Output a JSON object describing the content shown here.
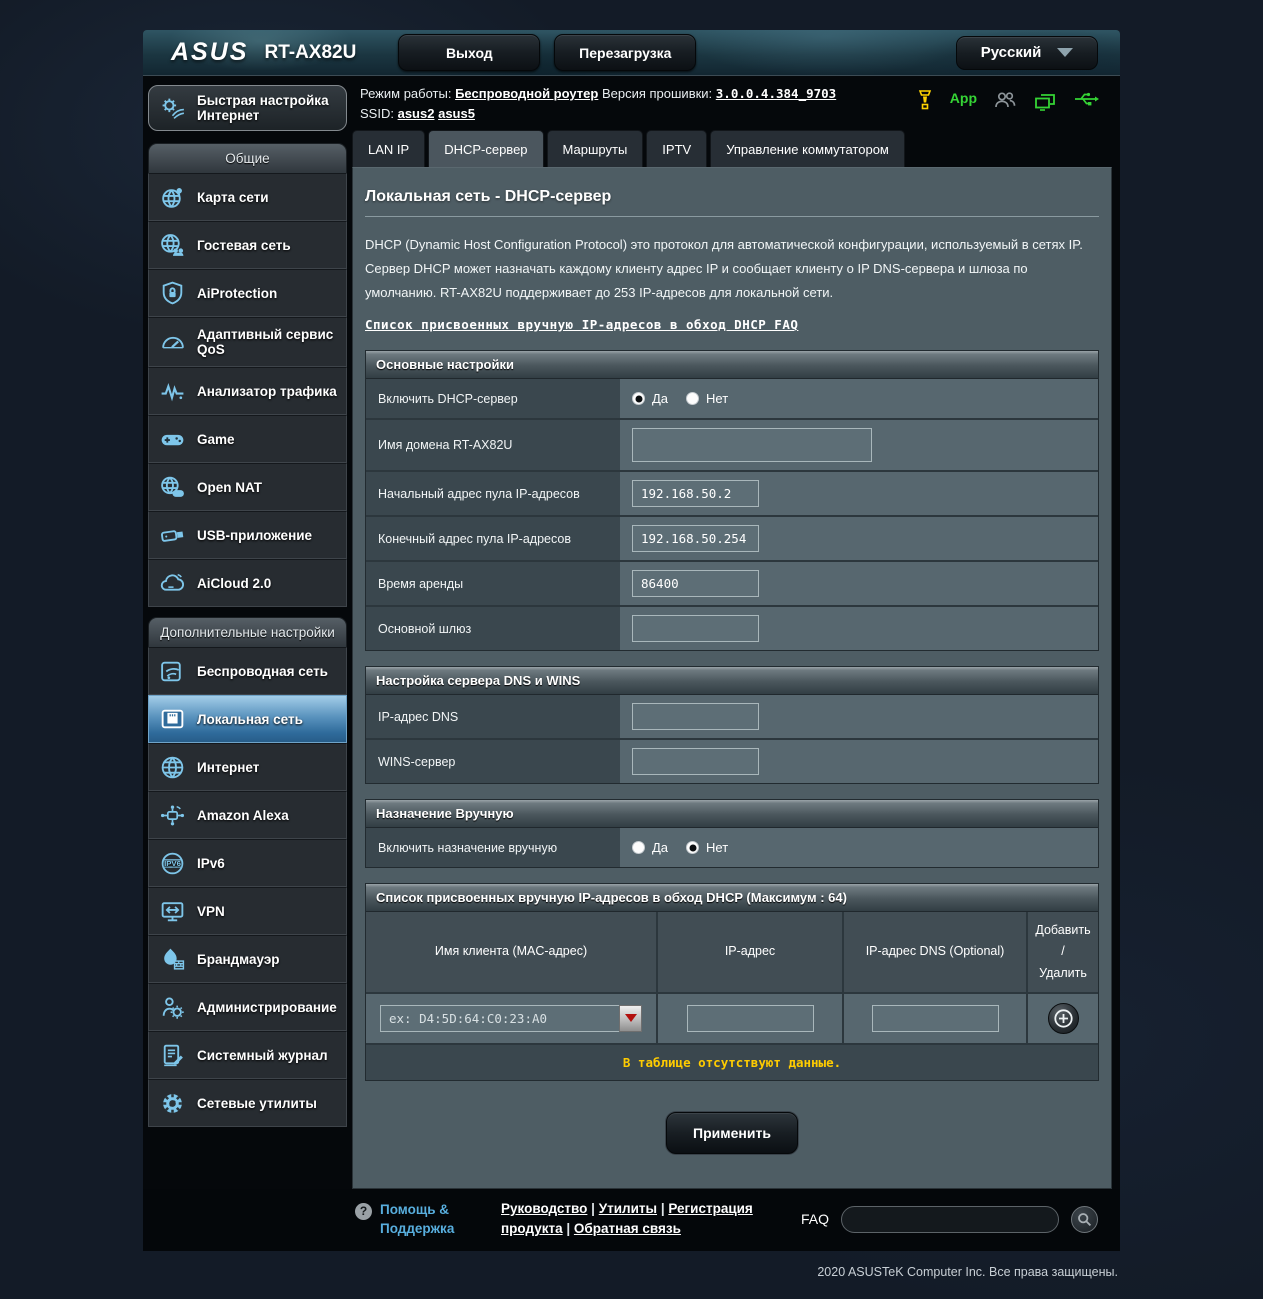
{
  "header": {
    "brand": "ASUS",
    "model": "RT-AX82U",
    "logout_label": "Выход",
    "reboot_label": "Перезагрузка",
    "language": "Русский",
    "app_badge": "App"
  },
  "statusbar": {
    "mode_label": "Режим работы:",
    "mode_value": "Беспроводной роутер",
    "firmware_label": "Версия прошивки:",
    "firmware_value": "3.0.0.4.384_9703",
    "ssid_label": "SSID:",
    "ssids": [
      "asus2",
      "asus5"
    ]
  },
  "tabs": [
    {
      "label": "LAN IP"
    },
    {
      "label": "DHCP-сервер"
    },
    {
      "label": "Маршруты"
    },
    {
      "label": "IPTV"
    },
    {
      "label": "Управление коммутатором"
    }
  ],
  "sidebar": {
    "quick_setup": "Быстрая настройка Интернет",
    "general_header": "Общие",
    "general_items": [
      "Карта сети",
      "Гостевая сеть",
      "AiProtection",
      "Адаптивный сервис QoS",
      "Анализатор трафика",
      "Game",
      "Open NAT",
      "USB-приложение",
      "AiCloud 2.0"
    ],
    "advanced_header": "Дополнительные настройки",
    "advanced_items": [
      "Беспроводная сеть",
      "Локальная сеть",
      "Интернет",
      "Amazon Alexa",
      "IPv6",
      "VPN",
      "Брандмауэр",
      "Администрирование",
      "Системный журнал",
      "Сетевые утилиты"
    ],
    "active_item": "Локальная сеть"
  },
  "main": {
    "title": "Локальная сеть - DHCP-сервер",
    "description": "DHCP (Dynamic Host Configuration Protocol) это протокол для автоматической конфигурации, используемый в сетях IP. Сервер DHCP может назначать каждому клиенту адрес IP и сообщает клиенту о IP DNS-сервера и шлюза по умолчанию. RT-AX82U поддерживает до 253 IP-адресов для локальной сети.",
    "faq_link": "Список присвоенных вручную IP-адресов в обход DHCP FAQ",
    "basic": {
      "header": "Основные настройки",
      "enable_dhcp": {
        "label": "Включить DHCP-сервер",
        "yes": "Да",
        "no": "Нет",
        "selected": "Да"
      },
      "domain": {
        "label": "Имя домена RT-AX82U",
        "value": ""
      },
      "pool_start": {
        "label": "Начальный адрес пула IP-адресов",
        "value": "192.168.50.2"
      },
      "pool_end": {
        "label": "Конечный адрес пула IP-адресов",
        "value": "192.168.50.254"
      },
      "lease": {
        "label": "Время аренды",
        "value": "86400"
      },
      "gateway": {
        "label": "Основной шлюз",
        "value": ""
      }
    },
    "dns_wins": {
      "header": "Настройка сервера DNS и WINS",
      "dns": {
        "label": "IP-адрес DNS",
        "value": ""
      },
      "wins": {
        "label": "WINS-сервер",
        "value": ""
      }
    },
    "manual": {
      "header": "Назначение Вручную",
      "enable": {
        "label": "Включить назначение вручную",
        "yes": "Да",
        "no": "Нет",
        "selected": "Нет"
      }
    },
    "manual_list": {
      "header": "Список присвоенных вручную IP-адресов в обход DHCP (Максимум : 64)",
      "col_client": "Имя клиента (MAC-адрес)",
      "col_ip": "IP-адрес",
      "col_dns": "IP-адрес DNS (Optional)",
      "col_add_line1": "Добавить /",
      "col_add_line2": "Удалить",
      "mac_placeholder": "ex: D4:5D:64:C0:23:A0",
      "ip_value": "",
      "dns_value": "",
      "empty_text": "В таблице отсутствуют данные."
    },
    "apply_label": "Применить"
  },
  "footer": {
    "help_label": "Помощь & Поддержка",
    "links": [
      "Руководство",
      "Утилиты",
      "Регистрация продукта",
      "Обратная связь"
    ],
    "separator": "|",
    "faq_label": "FAQ",
    "copyright": "2020 ASUSTeK Computer Inc. Все права защищены."
  },
  "colors": {
    "accent_blue": "#7ec6ea",
    "active_item_top": "#a3cde8",
    "warning_yellow": "#ffcc00",
    "status_green": "#35d435",
    "alert_yellow": "#ffd400",
    "content_bg": "#4e5d64",
    "label_cell_bg": "#3a474e",
    "value_cell_bg": "#57676f"
  }
}
